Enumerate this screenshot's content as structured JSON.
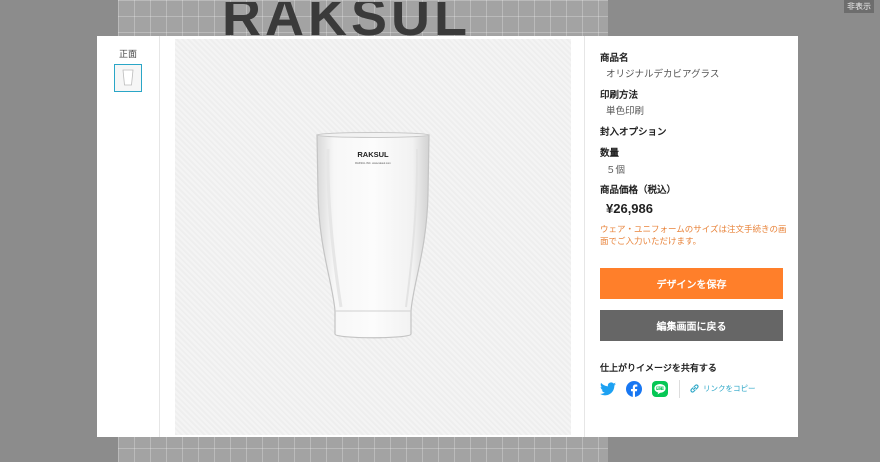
{
  "background": {
    "brand_text": "RAKSUL",
    "hide_label": "非表示"
  },
  "thumbnails": {
    "label": "正面"
  },
  "product": {
    "glass_print": "RAKSUL",
    "glass_small_print": "RAKSUL INC. www.raksul.com"
  },
  "details": {
    "name_label": "商品名",
    "name_value": "オリジナルデカビアグラス",
    "print_label": "印刷方法",
    "print_value": "単色印刷",
    "option_label": "封入オプション",
    "qty_label": "数量",
    "qty_value": "５個",
    "price_label": "商品価格（税込）",
    "price_value": "¥26,986",
    "note": "ウェア・ユニフォームのサイズは注文手続きの画面でご入力いただけます。"
  },
  "actions": {
    "save_label": "デザインを保存",
    "back_label": "編集画面に戻る"
  },
  "share": {
    "title": "仕上がりイメージを共有する",
    "icons": [
      "twitter-icon",
      "facebook-icon",
      "line-icon",
      "link-icon"
    ],
    "copy_label": "リンクをコピー"
  },
  "colors": {
    "accent": "#ff7f2a",
    "secondary_button": "#666666",
    "note": "#e8833a",
    "link": "#2aa6c7",
    "twitter": "#1da1f2",
    "facebook": "#1877f2",
    "line": "#06c755"
  }
}
